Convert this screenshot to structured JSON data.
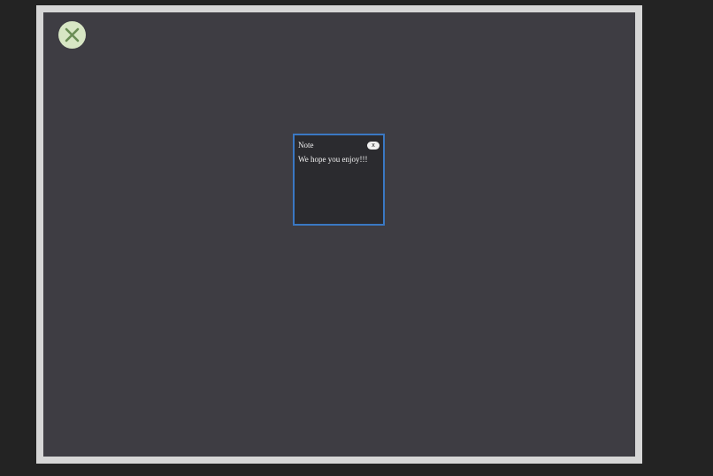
{
  "overlay": {
    "close_icon": "close-x-icon",
    "close_icon_color": "#6a8d55",
    "close_bg_color": "#d7e6c4"
  },
  "note": {
    "title": "Note",
    "close_label": "x",
    "body": "We hope you enjoy!!!",
    "border_color": "#3a78c3"
  }
}
